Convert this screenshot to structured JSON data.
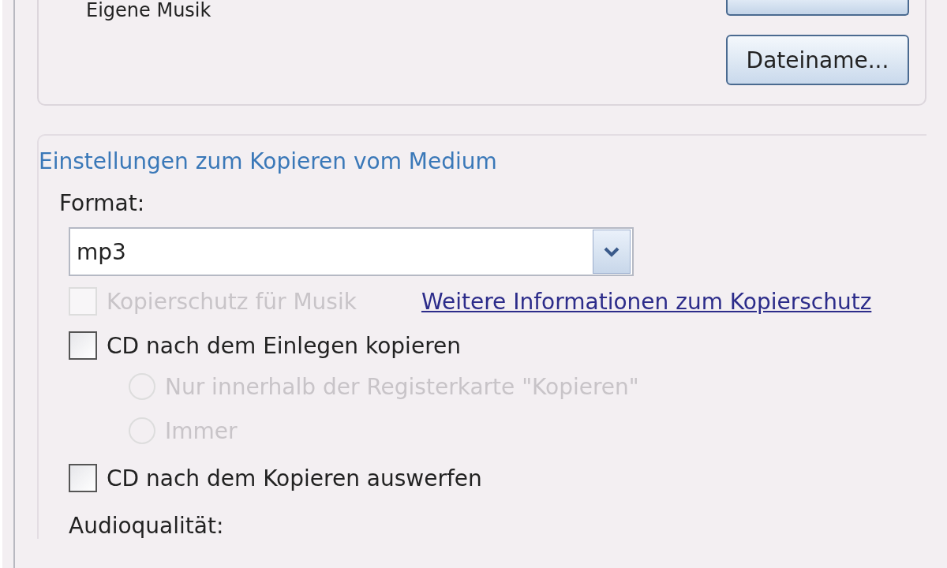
{
  "library_group": {
    "folder_label": "Eigene Musik",
    "filename_button": "Dateiname..."
  },
  "rip_group": {
    "title": "Einstellungen zum Kopieren vom Medium",
    "format_label": "Format:",
    "format_value": "mp3",
    "options": [
      {
        "kind": "checkbox",
        "label": "Kopierschutz für Musik",
        "checked": false,
        "disabled": true,
        "link": "Weitere Informationen zum Kopierschutz"
      },
      {
        "kind": "checkbox",
        "label": "CD nach dem Einlegen kopieren",
        "checked": false,
        "disabled": false
      },
      {
        "kind": "radio",
        "label": "Nur innerhalb der Registerkarte \"Kopieren\"",
        "selected": false,
        "disabled": true
      },
      {
        "kind": "radio",
        "label": "Immer",
        "selected": false,
        "disabled": true
      },
      {
        "kind": "checkbox",
        "label": "CD nach dem Kopieren auswerfen",
        "checked": false,
        "disabled": false
      }
    ],
    "quality_label": "Audioqualität:"
  }
}
